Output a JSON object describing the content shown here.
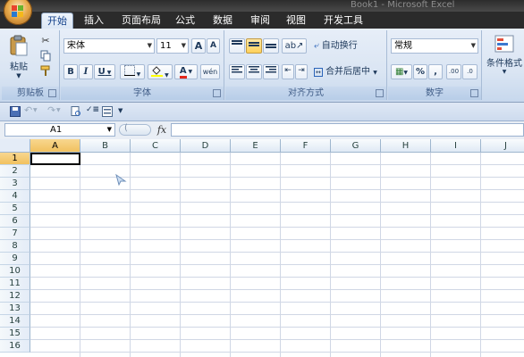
{
  "window": {
    "title": "Book1 - Microsoft Excel"
  },
  "tabs": [
    {
      "label": "开始",
      "active": true
    },
    {
      "label": "插入"
    },
    {
      "label": "页面布局"
    },
    {
      "label": "公式"
    },
    {
      "label": "数据"
    },
    {
      "label": "审阅"
    },
    {
      "label": "视图"
    },
    {
      "label": "开发工具"
    }
  ],
  "ribbon": {
    "clipboard": {
      "label": "剪贴板",
      "paste": "粘贴"
    },
    "font": {
      "label": "字体",
      "name": "宋体",
      "size": "11",
      "bold": "B",
      "italic": "I",
      "underline": "U",
      "grow": "A",
      "shrink": "A",
      "color_letter": "A",
      "phonetic": "wén"
    },
    "align": {
      "label": "对齐方式",
      "wrap": "自动换行",
      "merge": "合并后居中"
    },
    "number": {
      "label": "数字",
      "format": "常规",
      "percent": "%",
      "comma": ",",
      "inc_decimal": ".00",
      "dec_decimal": ".0"
    },
    "styles": {
      "conditional": "条件格式"
    }
  },
  "formula_bar": {
    "name_box": "A1",
    "fx": "fx",
    "value": ""
  },
  "grid": {
    "columns": [
      "A",
      "B",
      "C",
      "D",
      "E",
      "F",
      "G",
      "H",
      "I",
      "J"
    ],
    "rows": [
      "1",
      "2",
      "3",
      "4",
      "5",
      "6",
      "7",
      "8",
      "9",
      "10",
      "11",
      "12",
      "13",
      "14",
      "15",
      "16"
    ],
    "active_cell": "A1"
  },
  "colors": {
    "accent": "#f1c15f",
    "ribbon": "#dae5f3",
    "titlebar": "#2b2b2b"
  }
}
